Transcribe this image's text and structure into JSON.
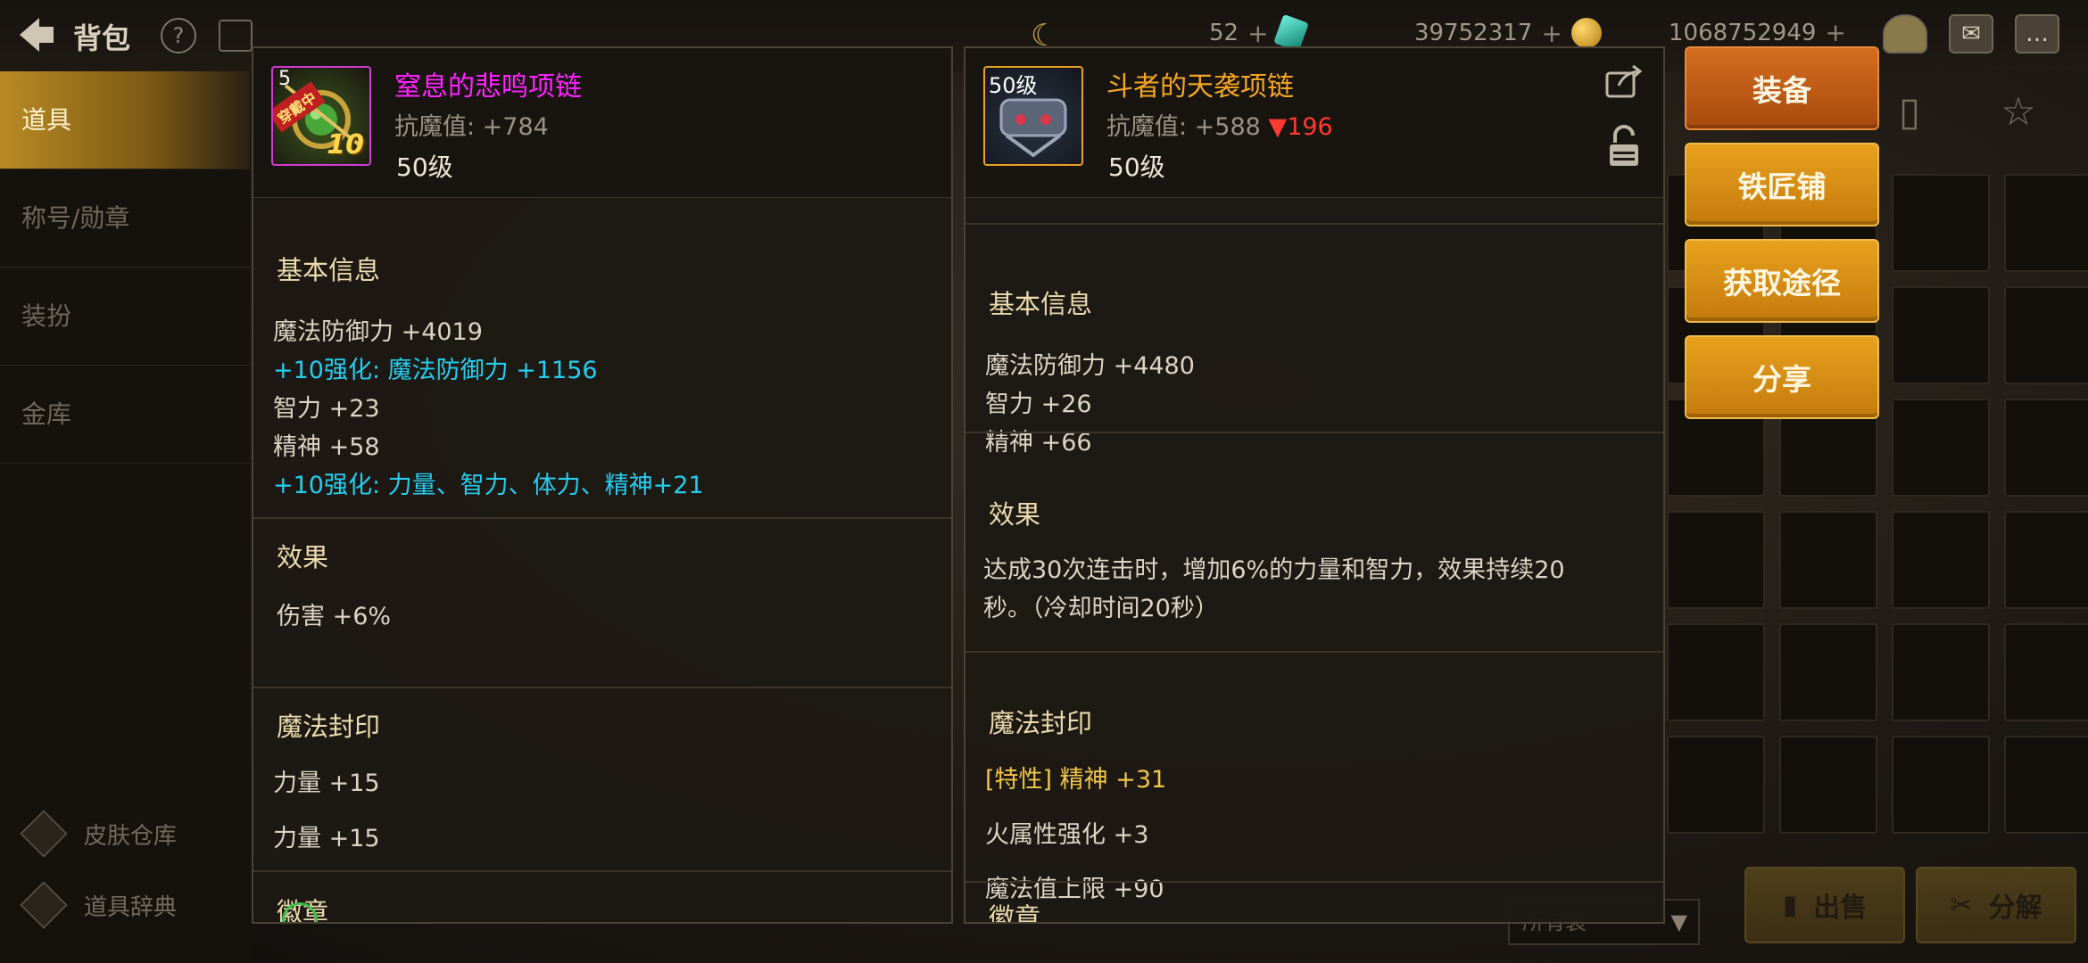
{
  "topbar": {
    "title": "背包",
    "currency_1_value": "52",
    "currency_2_value": "39752317",
    "currency_3_value": "1068752949"
  },
  "sidebar": {
    "tabs": [
      {
        "label": "道具",
        "active": true
      },
      {
        "label": "称号/勋章",
        "active": false
      },
      {
        "label": "装扮",
        "active": false
      },
      {
        "label": "金库",
        "active": false
      }
    ],
    "bottom_links": [
      {
        "label": "皮肤仓库"
      },
      {
        "label": "道具辞典"
      }
    ]
  },
  "inventory": {
    "sell_label": "出售",
    "disassemble_label": "分解",
    "sort_label": "所有装"
  },
  "left_item": {
    "name": "窒息的悲鸣项链",
    "name_color": "#ff22ff",
    "magic_resist": "抗魔值: +784",
    "level": "50级",
    "icon_badge": "穿戴中",
    "icon_level_prefix": "5",
    "icon_enhance": "10",
    "basic_title": "基本信息",
    "basic_lines": [
      {
        "text": "魔法防御力 +4019",
        "style": "normal"
      },
      {
        "text": "+10强化: 魔法防御力 +1156",
        "style": "cyan"
      },
      {
        "text": "智力 +23",
        "style": "normal"
      },
      {
        "text": "精神 +58",
        "style": "normal"
      },
      {
        "text": "+10强化: 力量、智力、体力、精神+21",
        "style": "cyan"
      }
    ],
    "effect_title": "效果",
    "effect_text": "伤害 +6%",
    "seal_title": "魔法封印",
    "seal_lines": [
      "力量 +15",
      "力量 +15"
    ],
    "emblem_title": "徽章"
  },
  "right_item": {
    "name": "斗者的天袭项链",
    "name_color": "#f5a623",
    "magic_resist": "抗魔值: +588",
    "resist_diff": "▼196",
    "level": "50级",
    "icon_level": "50级",
    "basic_title": "基本信息",
    "basic_lines": [
      {
        "text": "魔法防御力 +4480"
      },
      {
        "text": "智力 +26"
      },
      {
        "text": "精神 +66"
      }
    ],
    "effect_title": "效果",
    "effect_text": "达成30次连击时，增加6%的力量和智力，效果持续20秒。（冷却时间20秒）",
    "seal_title": "魔法封印",
    "seal_lines": [
      {
        "text": "[特性] 精神 +31",
        "style": "gold"
      },
      {
        "text": "火属性强化 +3",
        "style": "normal"
      },
      {
        "text": "魔法值上限 +90",
        "style": "normal"
      }
    ],
    "emblem_title": "徽章"
  },
  "actions": {
    "equip": "装备",
    "blacksmith": "铁匠铺",
    "obtain": "获取途径",
    "share": "分享"
  }
}
